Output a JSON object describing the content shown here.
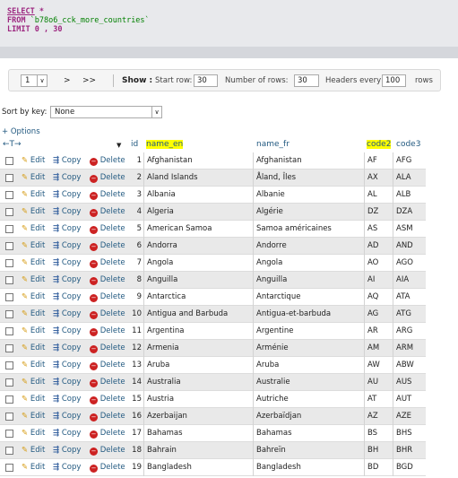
{
  "sql": {
    "select_kw": "SELECT",
    "star": " *",
    "from_kw": "FROM",
    "table": "`b78o6_cck_more_countries`",
    "limit_kw": "LIMIT",
    "limit_a": "0",
    "limit_sep": " , ",
    "limit_b": "30"
  },
  "nav": {
    "page": "1",
    "next": ">",
    "last": ">>",
    "show_label": "Show :",
    "start_row_label": "Start row:",
    "start_row": "30",
    "num_rows_label": "Number of rows:",
    "num_rows": "30",
    "headers_every_label": "Headers every",
    "headers_every": "100",
    "rows_label": "rows"
  },
  "sort": {
    "label": "Sort by key:",
    "value": "None"
  },
  "options_link": "+ Options",
  "columns": {
    "arrows": "←T→",
    "menu": "▼",
    "id": "id",
    "name_en": "name_en",
    "name_fr": "name_fr",
    "code2": "code2",
    "code3": "code3"
  },
  "actions": {
    "edit": "Edit",
    "copy": "Copy",
    "delete": "Delete"
  },
  "rows": [
    {
      "id": "1",
      "name_en": "Afghanistan",
      "name_fr": "Afghanistan",
      "code2": "AF",
      "code3": "AFG"
    },
    {
      "id": "2",
      "name_en": "Aland Islands",
      "name_fr": "Åland, Îles",
      "code2": "AX",
      "code3": "ALA"
    },
    {
      "id": "3",
      "name_en": "Albania",
      "name_fr": "Albanie",
      "code2": "AL",
      "code3": "ALB"
    },
    {
      "id": "4",
      "name_en": "Algeria",
      "name_fr": "Algérie",
      "code2": "DZ",
      "code3": "DZA"
    },
    {
      "id": "5",
      "name_en": "American Samoa",
      "name_fr": "Samoa américaines",
      "code2": "AS",
      "code3": "ASM"
    },
    {
      "id": "6",
      "name_en": "Andorra",
      "name_fr": "Andorre",
      "code2": "AD",
      "code3": "AND"
    },
    {
      "id": "7",
      "name_en": "Angola",
      "name_fr": "Angola",
      "code2": "AO",
      "code3": "AGO"
    },
    {
      "id": "8",
      "name_en": "Anguilla",
      "name_fr": "Anguilla",
      "code2": "AI",
      "code3": "AIA"
    },
    {
      "id": "9",
      "name_en": "Antarctica",
      "name_fr": "Antarctique",
      "code2": "AQ",
      "code3": "ATA"
    },
    {
      "id": "10",
      "name_en": "Antigua and Barbuda",
      "name_fr": "Antigua-et-barbuda",
      "code2": "AG",
      "code3": "ATG"
    },
    {
      "id": "11",
      "name_en": "Argentina",
      "name_fr": "Argentine",
      "code2": "AR",
      "code3": "ARG"
    },
    {
      "id": "12",
      "name_en": "Armenia",
      "name_fr": "Arménie",
      "code2": "AM",
      "code3": "ARM"
    },
    {
      "id": "13",
      "name_en": "Aruba",
      "name_fr": "Aruba",
      "code2": "AW",
      "code3": "ABW"
    },
    {
      "id": "14",
      "name_en": "Australia",
      "name_fr": "Australie",
      "code2": "AU",
      "code3": "AUS"
    },
    {
      "id": "15",
      "name_en": "Austria",
      "name_fr": "Autriche",
      "code2": "AT",
      "code3": "AUT"
    },
    {
      "id": "16",
      "name_en": "Azerbaijan",
      "name_fr": "Azerbaïdjan",
      "code2": "AZ",
      "code3": "AZE"
    },
    {
      "id": "17",
      "name_en": "Bahamas",
      "name_fr": "Bahamas",
      "code2": "BS",
      "code3": "BHS"
    },
    {
      "id": "18",
      "name_en": "Bahrain",
      "name_fr": "Bahreïn",
      "code2": "BH",
      "code3": "BHR"
    },
    {
      "id": "19",
      "name_en": "Bangladesh",
      "name_fr": "Bangladesh",
      "code2": "BD",
      "code3": "BGD"
    }
  ]
}
